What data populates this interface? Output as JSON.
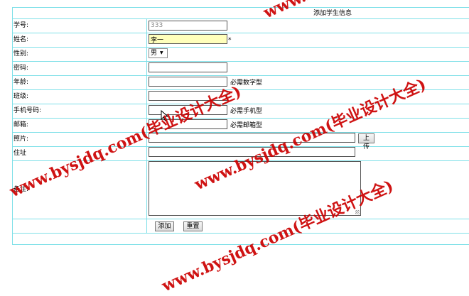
{
  "form": {
    "title": "添加学生信息",
    "fields": {
      "student_id": {
        "label": "学号:",
        "value": "333"
      },
      "name": {
        "label": "姓名:",
        "value": "李一",
        "required_mark": "*"
      },
      "gender": {
        "label": "性别:",
        "value": "男"
      },
      "password": {
        "label": "密码:",
        "value": ""
      },
      "age": {
        "label": "年龄:",
        "value": "",
        "hint": "必需数字型"
      },
      "class": {
        "label": "班级:",
        "value": ""
      },
      "phone": {
        "label": "手机号码:",
        "value": "",
        "hint": "必需手机型"
      },
      "email": {
        "label": "邮箱:",
        "value": "",
        "hint": "必需邮箱型"
      },
      "photo": {
        "label": "照片:",
        "value": "",
        "upload_label": "上传"
      },
      "address": {
        "label": "住址",
        "value": ""
      },
      "remarks": {
        "label": "备注:",
        "value": ""
      }
    },
    "buttons": {
      "submit": "添加",
      "reset": "重置"
    }
  },
  "watermark": {
    "text": "www.bysjdq.com(毕业设计大全)",
    "color": "#cc0000"
  }
}
